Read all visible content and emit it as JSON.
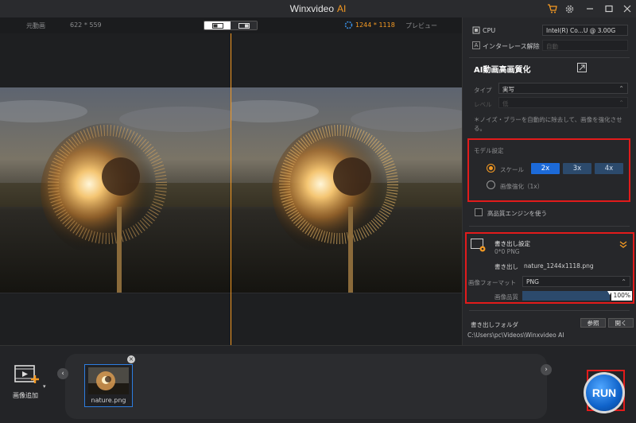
{
  "app": {
    "title": "Winxvideo",
    "title_accent": "AI"
  },
  "viewer": {
    "original_label": "元動画",
    "original_size": "622 * 559",
    "output_size": "1244 * 1118",
    "preview_label": "プレビュー"
  },
  "panel": {
    "cpu_label": "CPU",
    "cpu_value": "Intel(R) Co...U @ 3.00G",
    "deinterlace_label": "インターレース解除",
    "deinterlace_value": "自動",
    "section_title": "AI動画高画質化",
    "type_label": "タイプ",
    "type_value": "実写",
    "level_label": "レベル",
    "level_value": "低",
    "description": "＊ノイズ・ブラーを自動的に除去して、画像を強化させる。",
    "model_settings_title": "モデル設定",
    "scale_label": "スケール",
    "scale_options": [
      "2x",
      "3x",
      "4x"
    ],
    "enhance_label": "画像強化（1x）",
    "hq_engine_label": "高品質エンジンを使う"
  },
  "export": {
    "title": "書き出し設定",
    "summary": "0*0  PNG",
    "output_label": "書き出し",
    "output_filename": "nature_1244x1118.png",
    "format_label": "画像フォーマット",
    "format_value": "PNG",
    "quality_label": "画像品質",
    "quality_value": "100%",
    "quality_fraction": 1.0,
    "folder_label": "書き出しフォルダ",
    "browse_label": "参照",
    "open_label": "開く",
    "folder_path": "C:\\Users\\pc\\Videos\\Winxvideo AI"
  },
  "bottom": {
    "add_image_label": "画像追加",
    "thumbnail_name": "nature.png",
    "run_label": "RUN"
  },
  "colors": {
    "accent": "#f59a23",
    "selected_blue": "#1c6ad8",
    "highlight_red": "#e21b1b"
  }
}
